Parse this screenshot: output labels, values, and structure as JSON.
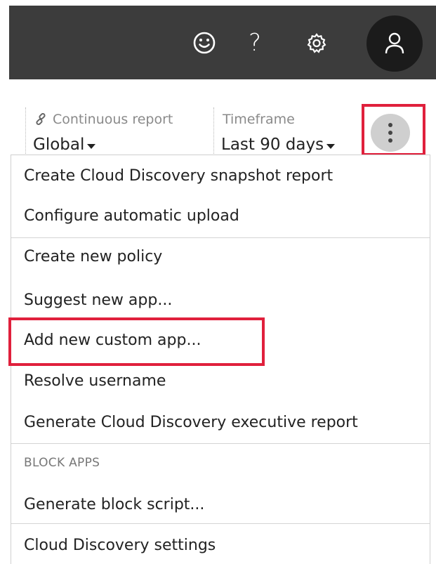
{
  "header": {
    "icons": [
      "smiley-icon",
      "help-icon",
      "gear-icon",
      "user-icon"
    ],
    "help_glyph": "?"
  },
  "filters": {
    "report": {
      "label": "Continuous report",
      "value": "Global"
    },
    "timeframe": {
      "label": "Timeframe",
      "value": "Last 90 days"
    }
  },
  "menu": {
    "items": [
      "Create Cloud Discovery snapshot report",
      "Configure automatic upload",
      "Create new policy",
      "Suggest new app...",
      "Add new custom app...",
      "Resolve username",
      "Generate Cloud Discovery executive report",
      "Generate block script...",
      "Cloud Discovery settings"
    ],
    "section_header": "BLOCK APPS"
  },
  "colors": {
    "topbar": "#3c3c3c",
    "highlight": "#e0203c",
    "avatar": "#1b1b1b"
  }
}
